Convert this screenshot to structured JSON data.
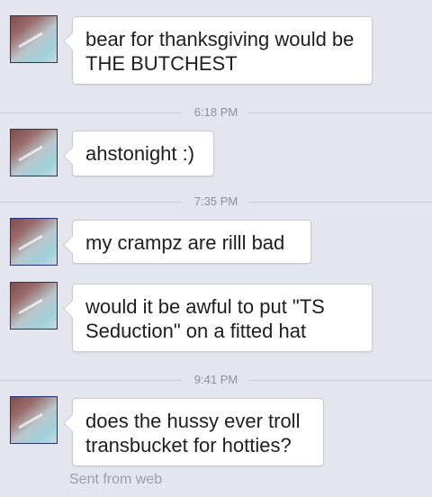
{
  "messages": [
    {
      "text": "bear for thanksgiving would be THE BUTCHEST"
    },
    {
      "text": "ahstonight :)"
    },
    {
      "text": "my crampz are rilll bad"
    },
    {
      "text": "would it be awful to put \"TS Seduction\" on a fitted hat"
    },
    {
      "text": "does the hussy ever troll transbucket for hotties?"
    }
  ],
  "timestamps": [
    "6:18 PM",
    "7:35 PM",
    "9:41 PM"
  ],
  "footer": {
    "sent_from": "Sent from web"
  }
}
